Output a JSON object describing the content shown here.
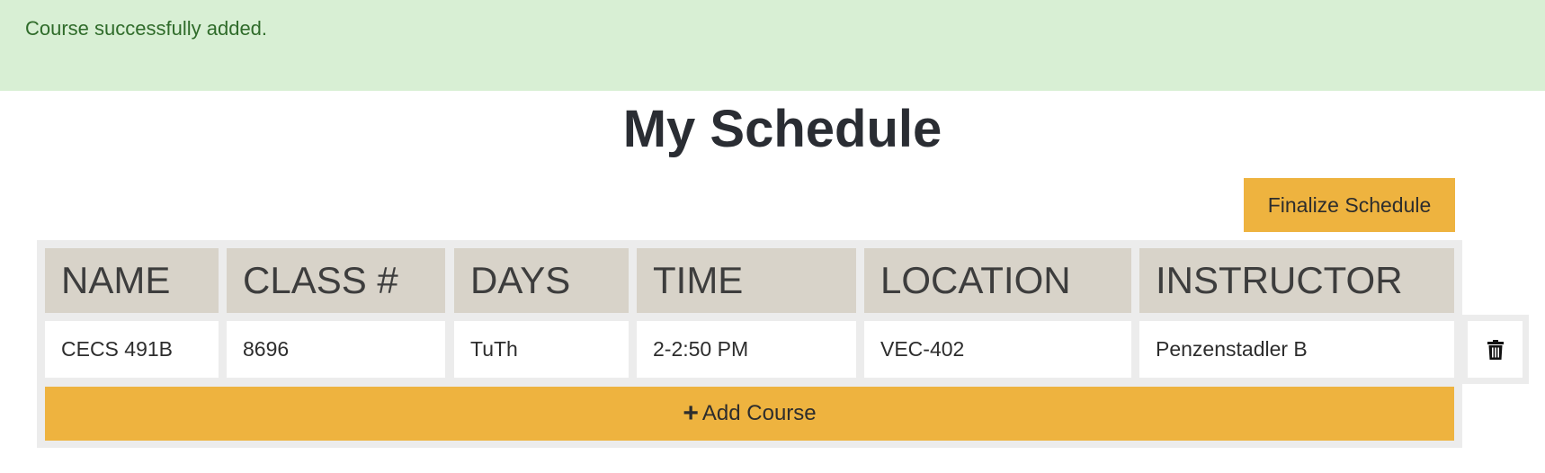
{
  "alert": {
    "message": "Course successfully added."
  },
  "page": {
    "title": "My Schedule"
  },
  "actions": {
    "finalize_label": "Finalize Schedule",
    "add_course_label": "Add Course"
  },
  "table": {
    "headers": [
      "NAME",
      "CLASS #",
      "DAYS",
      "TIME",
      "LOCATION",
      "INSTRUCTOR"
    ],
    "rows": [
      {
        "name": "CECS 491B",
        "class_num": "8696",
        "days": "TuTh",
        "time": "2-2:50 PM",
        "location": "VEC-402",
        "instructor": "Penzenstadler B"
      }
    ]
  },
  "icons": {
    "delete": "trash-icon",
    "add": "plus-icon"
  },
  "colors": {
    "success_bg": "#d8efd4",
    "success_text": "#2f6b2a",
    "accent": "#eeb33f",
    "header_bg": "#d8d3c9"
  }
}
